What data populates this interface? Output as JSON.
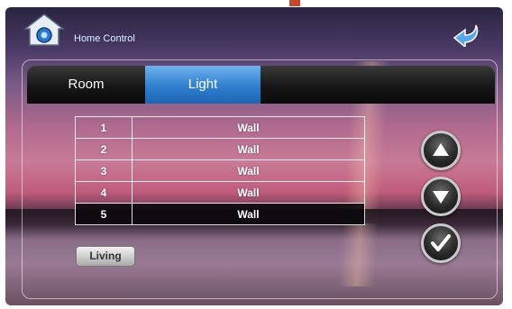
{
  "header": {
    "title": "Home Control",
    "home_icon": "home-icon",
    "back_icon": "back-arrow-icon"
  },
  "tabs": [
    {
      "label": "Room",
      "active": false
    },
    {
      "label": "Light",
      "active": true
    }
  ],
  "zones": [
    {
      "number": "1",
      "name": "Wall"
    },
    {
      "number": "2",
      "name": "Wall"
    },
    {
      "number": "3",
      "name": "Wall"
    },
    {
      "number": "4",
      "name": "Wall"
    },
    {
      "number": "5",
      "name": "Wall",
      "selected": true
    }
  ],
  "room_button": {
    "label": "Living"
  },
  "controls": {
    "up_icon": "triangle-up-icon",
    "down_icon": "triangle-down-icon",
    "confirm_icon": "checkmark-icon"
  },
  "colors": {
    "active_tab": "#2f7fd0",
    "tab_bar": "#161616",
    "selected_row": "#0a080c"
  }
}
